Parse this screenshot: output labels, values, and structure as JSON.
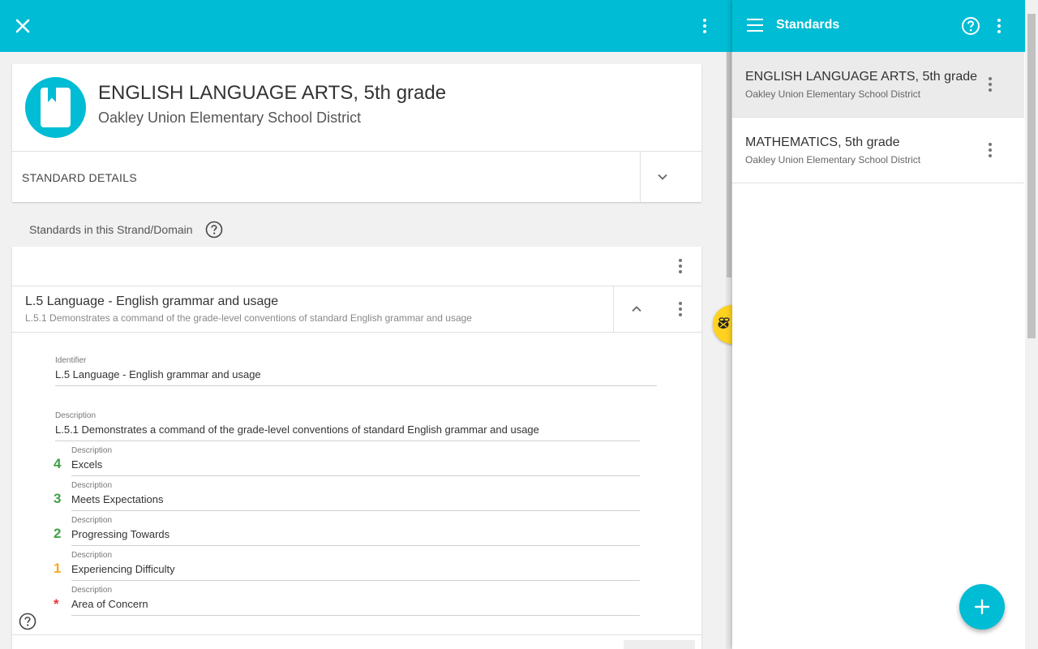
{
  "header": {
    "title": "ENGLISH LANGUAGE ARTS, 5th grade",
    "subtitle": "Oakley Union Elementary School District",
    "details_label": "STANDARD DETAILS"
  },
  "strand": {
    "label": "Standards in this Strand/Domain"
  },
  "standard": {
    "title": "L.5 Language - English grammar and usage",
    "description": "L.5.1 Demonstrates a command of the grade-level conventions of standard English grammar and usage"
  },
  "form": {
    "identifier_label": "Identifier",
    "identifier_value": "L.5 Language - English grammar and usage",
    "description_label": "Description",
    "description_value": "L.5.1 Demonstrates a command of the grade-level conventions of standard English grammar and usage",
    "rubric": [
      {
        "level": "4",
        "label": "Description",
        "value": "Excels",
        "color": "#43a047"
      },
      {
        "level": "3",
        "label": "Description",
        "value": "Meets Expectations",
        "color": "#43a047"
      },
      {
        "level": "2",
        "label": "Description",
        "value": "Progressing Towards",
        "color": "#43a047"
      },
      {
        "level": "1",
        "label": "Description",
        "value": "Experiencing Difficulty",
        "color": "#f9a825"
      },
      {
        "level": "*",
        "label": "Description",
        "value": "Area of Concern",
        "color": "#e53935"
      }
    ]
  },
  "panel": {
    "title": "Standards",
    "items": [
      {
        "title": "ENGLISH LANGUAGE ARTS, 5th grade",
        "subtitle": "Oakley Union Elementary School District"
      },
      {
        "title": "MATHEMATICS, 5th grade",
        "subtitle": "Oakley Union Elementary School District"
      }
    ]
  },
  "colors": {
    "accent": "#00bcd4",
    "bee": "#ffd21f"
  }
}
